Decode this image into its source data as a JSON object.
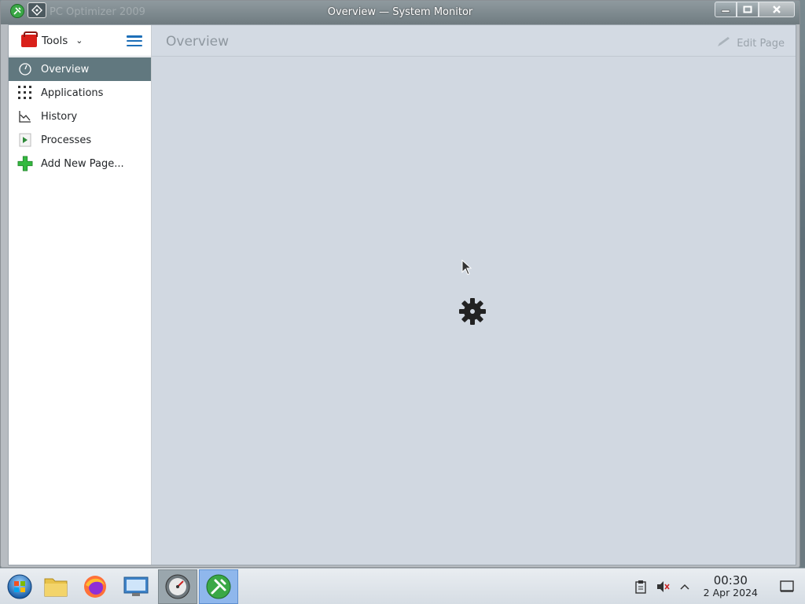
{
  "window": {
    "title": "Overview — System Monitor",
    "background_ghost_title": "PC Optimizer 2009",
    "buttons": [
      "minimize",
      "maximize",
      "close"
    ]
  },
  "sidebar": {
    "tools_label": "Tools",
    "items": [
      {
        "label": "Overview",
        "icon": "gauge-icon",
        "active": true
      },
      {
        "label": "Applications",
        "icon": "applications-grid-icon",
        "active": false
      },
      {
        "label": "History",
        "icon": "line-chart-icon",
        "active": false
      },
      {
        "label": "Processes",
        "icon": "process-play-icon",
        "active": false
      },
      {
        "label": "Add New Page...",
        "icon": "plus-icon",
        "active": false
      }
    ]
  },
  "main": {
    "page_title": "Overview",
    "edit_page_label": "Edit Page"
  },
  "taskbar": {
    "apps": [
      "start-orb",
      "file-manager",
      "firefox",
      "system-settings",
      "system-monitor-gauge",
      "pc-optimizer"
    ],
    "clock": {
      "time": "00:30",
      "date": "2 Apr 2024"
    }
  },
  "colors": {
    "sidebar_active_bg": "#61787f",
    "content_bg": "#d1d8e1",
    "accent_blue": "#1d6fb8",
    "green": "#2fb43a"
  }
}
